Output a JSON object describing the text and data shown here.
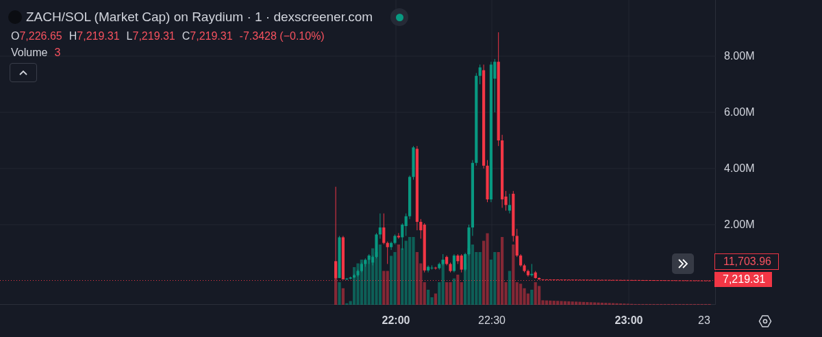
{
  "header": {
    "title": "ZACH/SOL (Market Cap) on Raydium · 1 · dexscreener.com"
  },
  "ohlc": [
    {
      "label": "O",
      "value": "7,226.65"
    },
    {
      "label": "H",
      "value": "7,219.31"
    },
    {
      "label": "L",
      "value": "7,219.31"
    },
    {
      "label": "C",
      "value": "7,219.31"
    }
  ],
  "change": "-7.3428 (−0.10%)",
  "volume": {
    "label": "Volume",
    "value": "3"
  },
  "price_axis": {
    "ticks": [
      "8.00M",
      "6.00M",
      "4.00M",
      "2.00M"
    ]
  },
  "price_tags": [
    {
      "kind": "outline",
      "value": "11,703.96"
    },
    {
      "kind": "filled",
      "value": "7,219.31"
    }
  ],
  "time_axis": {
    "ticks": [
      {
        "label": "22:00",
        "kind": "major"
      },
      {
        "label": "22:30",
        "kind": "minor"
      },
      {
        "label": "23:00",
        "kind": "major"
      },
      {
        "label": "23",
        "kind": "minor"
      }
    ]
  }
}
